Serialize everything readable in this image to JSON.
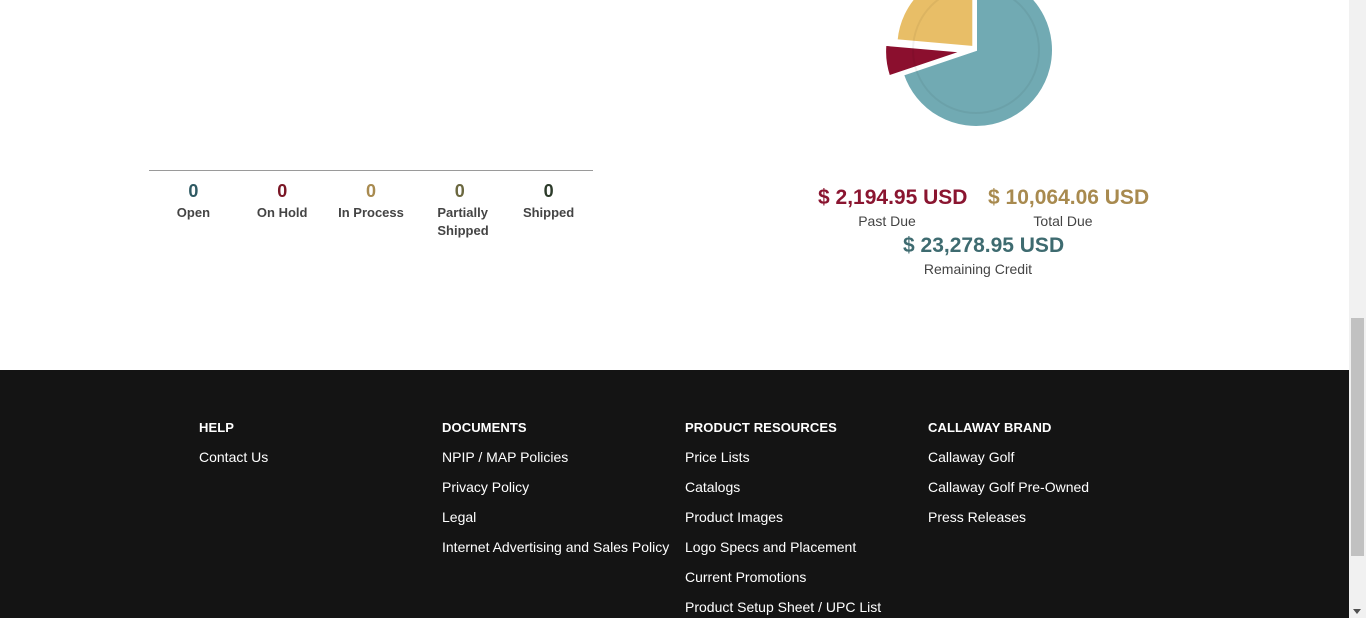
{
  "order_status": [
    {
      "count": "0",
      "label": "Open",
      "color": "#2f5a63"
    },
    {
      "count": "0",
      "label": "On Hold",
      "color": "#7a1625"
    },
    {
      "count": "0",
      "label": "In Process",
      "color": "#a88a4f"
    },
    {
      "count": "0",
      "label": "Partially Shipped",
      "color": "#6b6840"
    },
    {
      "count": "0",
      "label": "Shipped",
      "color": "#2c3b2a"
    }
  ],
  "credit": {
    "past_due": {
      "amount": "$ 2,194.95 USD",
      "label": "Past Due",
      "color": "#8a1530"
    },
    "total_due": {
      "amount": "$ 10,064.06 USD",
      "label": "Total Due",
      "color": "#a88a4f"
    },
    "remaining": {
      "amount": "$ 23,278.95 USD",
      "label": "Remaining Credit",
      "color": "#3e6b70"
    }
  },
  "chart_data": {
    "type": "pie",
    "series": [
      {
        "values": [
          2194.95,
          7869.11,
          23278.95
        ]
      }
    ],
    "colors": [
      "#8b0f2e",
      "#e8be67",
      "#71aab3"
    ]
  },
  "footer": {
    "columns": [
      {
        "heading": "HELP",
        "links": [
          "Contact Us"
        ]
      },
      {
        "heading": "DOCUMENTS",
        "links": [
          "NPIP / MAP Policies",
          "Privacy Policy",
          "Legal",
          "Internet Advertising and Sales Policy"
        ]
      },
      {
        "heading": "PRODUCT RESOURCES",
        "links": [
          "Price Lists",
          "Catalogs",
          "Product Images",
          "Logo Specs and Placement",
          "Current Promotions",
          "Product Setup Sheet / UPC List"
        ]
      },
      {
        "heading": "CALLAWAY BRAND",
        "links": [
          "Callaway Golf",
          "Callaway Golf Pre-Owned",
          "Press Releases"
        ]
      }
    ]
  }
}
